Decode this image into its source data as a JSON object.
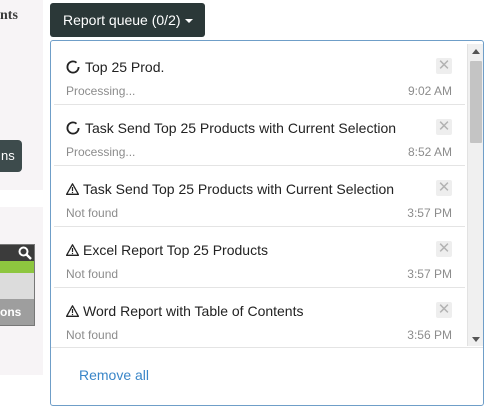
{
  "background": {
    "heading_fragment": "nts",
    "button_fragment": "ns",
    "table_footer_fragment": "ons"
  },
  "queue_button": {
    "label": "Report queue (0/2)"
  },
  "items": [
    {
      "icon": "spinner-icon",
      "title": "Top 25 Prod.",
      "status": "Processing...",
      "time": "9:02 AM"
    },
    {
      "icon": "spinner-icon",
      "title": "Task Send Top 25 Products with Current Selection",
      "status": "Processing...",
      "time": "8:52 AM"
    },
    {
      "icon": "warning-icon",
      "title": "Task Send Top 25 Products with Current Selection",
      "status": "Not found",
      "time": "3:57 PM"
    },
    {
      "icon": "warning-icon",
      "title": "Excel Report Top 25 Products",
      "status": "Not found",
      "time": "3:57 PM"
    },
    {
      "icon": "warning-icon",
      "title": "Word Report with Table of Contents",
      "status": "Not found",
      "time": "3:56 PM"
    }
  ],
  "footer": {
    "remove_all_label": "Remove all"
  },
  "colors": {
    "button_bg": "#2b3838",
    "panel_border": "#6f9ec8",
    "link": "#3a86c8",
    "accent_green": "#8dc63f"
  }
}
